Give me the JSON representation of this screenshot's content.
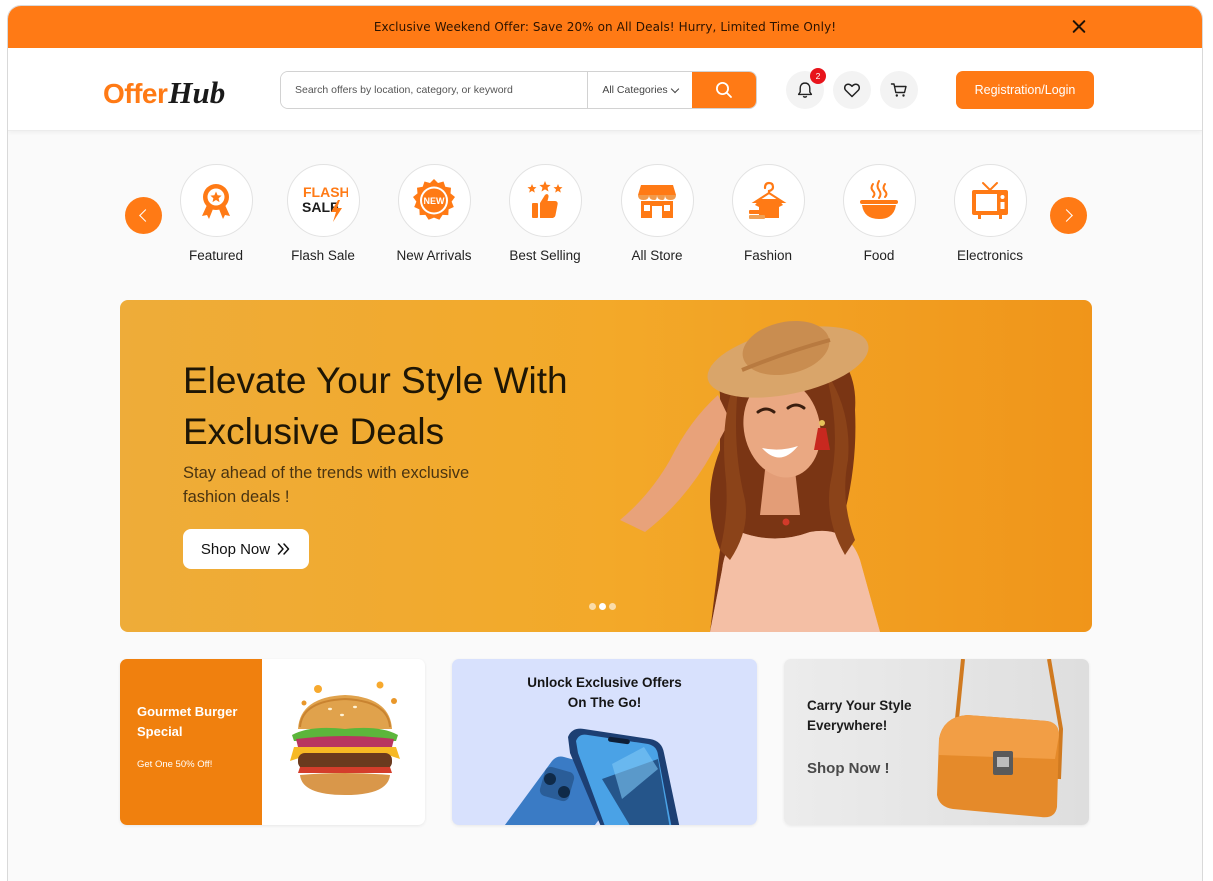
{
  "promo": {
    "text": "Exclusive Weekend Offer: Save 20% on All Deals! Hurry, Limited Time Only!"
  },
  "header": {
    "logo_part1": "Offer",
    "logo_part2": "Hub",
    "search_placeholder": "Search offers by location, category, or keyword",
    "category_select": "All Categories",
    "notification_count": "2",
    "login_label": "Registration/Login"
  },
  "categories": [
    {
      "label": "Featured",
      "icon": "award-badge-icon"
    },
    {
      "label": "Flash Sale",
      "icon": "flash-sale-icon",
      "icon_text_1": "FLASH",
      "icon_text_2": "SALE"
    },
    {
      "label": "New Arrivals",
      "icon": "new-badge-icon",
      "icon_text": "NEW"
    },
    {
      "label": "Best Selling",
      "icon": "thumbs-up-stars-icon"
    },
    {
      "label": "All Store",
      "icon": "storefront-icon"
    },
    {
      "label": "Fashion",
      "icon": "clothes-hanger-icon"
    },
    {
      "label": "Food",
      "icon": "food-bowl-icon"
    },
    {
      "label": "Electronics",
      "icon": "television-icon"
    }
  ],
  "hero": {
    "title_line1": "Elevate Your Style With",
    "title_line2": "Exclusive Deals",
    "subtitle": "Stay ahead of the trends with exclusive fashion deals !",
    "button": "Shop Now",
    "slide_count": 3,
    "active_slide": 2
  },
  "cards": [
    {
      "title": "Gourmet Burger Special",
      "subtitle": "Get One 50% Off!",
      "image": "burger-image"
    },
    {
      "title_line1": "Unlock Exclusive Offers",
      "title_line2": "On The Go!",
      "image": "smartphone-image"
    },
    {
      "title_line1": "Carry Your Style",
      "title_line2": "Everywhere!",
      "link": "Shop Now !",
      "image": "handbag-image"
    }
  ],
  "colors": {
    "accent": "#ff7a15",
    "hero_bg": "#f3a929",
    "card2_bg": "#d8e1fd",
    "badge": "#e8141b"
  }
}
